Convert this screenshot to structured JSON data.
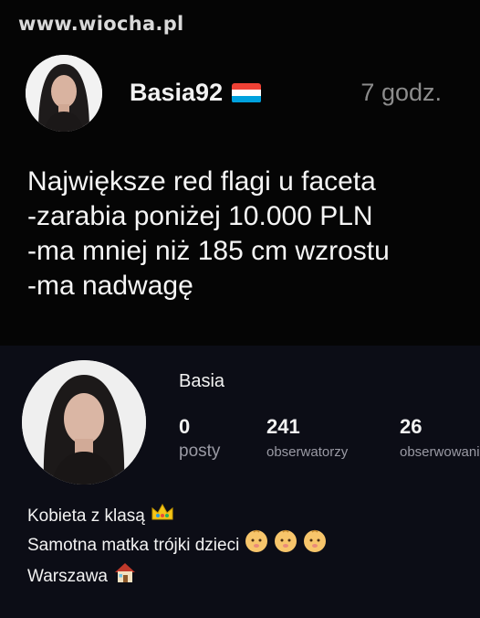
{
  "watermark": "www.wiocha.pl",
  "post": {
    "username": "Basia92",
    "flag_icon": "luxembourg-flag-icon",
    "flag_colors": [
      "#ef4135",
      "#ffffff",
      "#00a1de"
    ],
    "time": "7 godz.",
    "lines": [
      "Największe red flagi u faceta",
      "-zarabia poniżej 10.000 PLN",
      "-ma mniej niż 185 cm wzrostu",
      "-ma nadwagę"
    ]
  },
  "profile": {
    "name": "Basia",
    "stats": [
      {
        "value": "0",
        "label": "posty"
      },
      {
        "value": "241",
        "label": "obserwatorzy"
      },
      {
        "value": "26",
        "label": "obserwowani"
      }
    ],
    "bio": [
      {
        "text": "Kobieta z klasą",
        "icons": [
          "crown-icon"
        ]
      },
      {
        "text": "Samotna matka trójki dzieci",
        "icons": [
          "baby-icon",
          "baby-icon",
          "baby-icon"
        ]
      },
      {
        "text": "Warszawa",
        "icons": [
          "house-icon"
        ]
      }
    ]
  },
  "colors": {
    "post_bg": "#050505",
    "profile_bg": "#0c0d16",
    "muted": "#8c8c8c"
  }
}
